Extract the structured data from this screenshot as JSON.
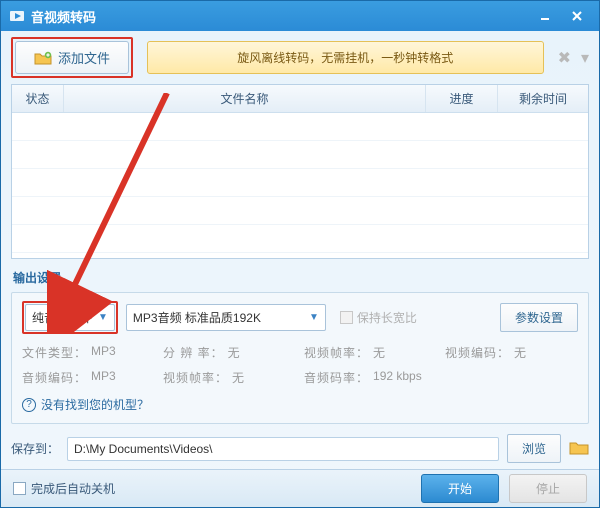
{
  "titlebar": {
    "title": "音视频转码"
  },
  "toolbar": {
    "add_file": "添加文件",
    "hint": "旋风离线转码，无需挂机，一秒钟转格式"
  },
  "table": {
    "headers": {
      "status": "状态",
      "name": "文件名称",
      "progress": "进度",
      "remain": "剩余时间"
    }
  },
  "output": {
    "section": "输出设置",
    "type_dropdown": "纯音频文件",
    "profile_dropdown": "MP3音频 标准品质192K",
    "keep_aspect": "保持长宽比",
    "param_btn": "参数设置"
  },
  "info": {
    "file_type_lbl": "文件类型：",
    "file_type_val": "MP3",
    "resolution_lbl": "分 辨 率：",
    "resolution_val": "无",
    "vfps_lbl": "视频帧率：",
    "vfps_val": "无",
    "vcodec_lbl": "视频编码：",
    "vcodec_val": "无",
    "acodec_lbl": "音频编码：",
    "acodec_val": "MP3",
    "afps_lbl": "视频帧率：",
    "afps_val": "无",
    "abit_lbl": "音频码率：",
    "abit_val": "192 kbps"
  },
  "help": {
    "text": "没有找到您的机型？"
  },
  "save": {
    "label": "保存到：",
    "path": "D:\\My Documents\\Videos\\",
    "browse": "浏览"
  },
  "footer": {
    "shutdown": "完成后自动关机",
    "start": "开始",
    "stop": "停止"
  }
}
